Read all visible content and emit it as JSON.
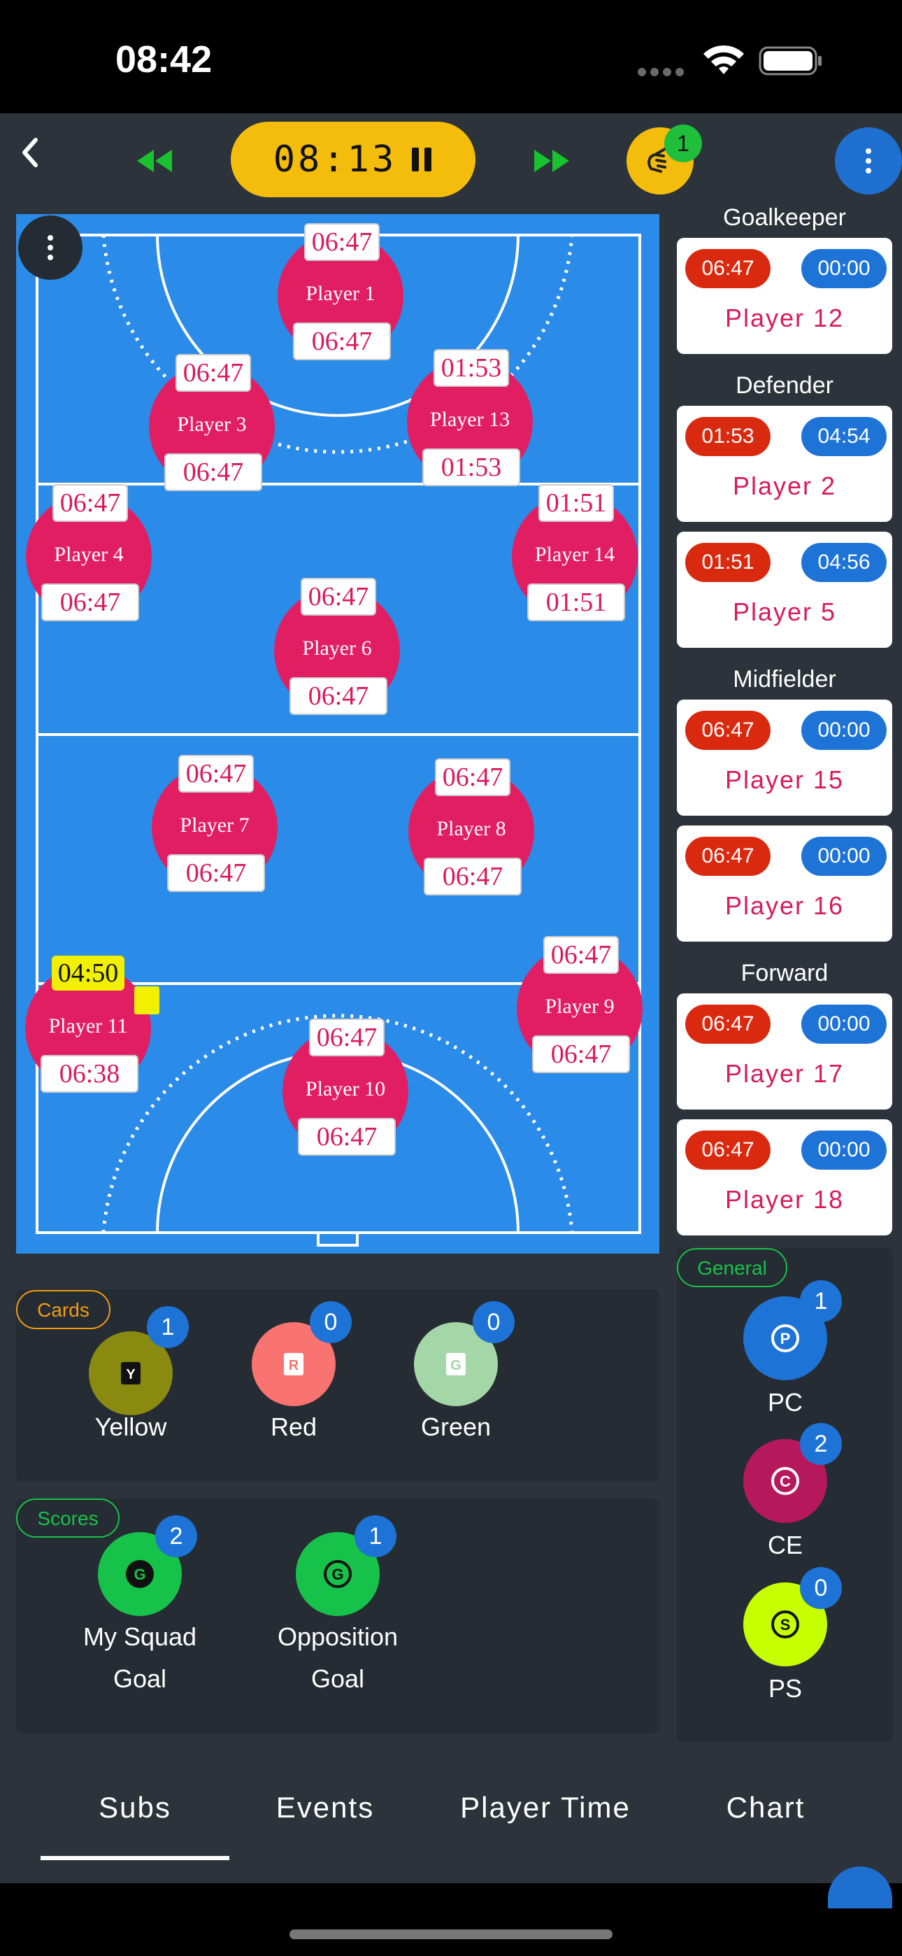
{
  "status_bar": {
    "time": "08:42"
  },
  "toolbar": {
    "timer": "08:13",
    "notification_count": "1"
  },
  "court_players": [
    {
      "name": "Player 1",
      "top_time": "06:47",
      "bottom_time": "06:47"
    },
    {
      "name": "Player 3",
      "top_time": "06:47",
      "bottom_time": "06:47"
    },
    {
      "name": "Player 13",
      "top_time": "01:53",
      "bottom_time": "01:53"
    },
    {
      "name": "Player 4",
      "top_time": "06:47",
      "bottom_time": "06:47"
    },
    {
      "name": "Player 14",
      "top_time": "01:51",
      "bottom_time": "01:51"
    },
    {
      "name": "Player 6",
      "top_time": "06:47",
      "bottom_time": "06:47"
    },
    {
      "name": "Player 7",
      "top_time": "06:47",
      "bottom_time": "06:47"
    },
    {
      "name": "Player 8",
      "top_time": "06:47",
      "bottom_time": "06:47"
    },
    {
      "name": "Player 11",
      "top_time": "04:50",
      "bottom_time": "06:38"
    },
    {
      "name": "Player 9",
      "top_time": "06:47",
      "bottom_time": "06:47"
    },
    {
      "name": "Player 10",
      "top_time": "06:47",
      "bottom_time": "06:47"
    }
  ],
  "bench": {
    "goalkeeper_label": "Goalkeeper",
    "defender_label": "Defender",
    "midfielder_label": "Midfielder",
    "forward_label": "Forward",
    "players": [
      {
        "name": "Player 12",
        "on_time": "06:47",
        "off_time": "00:00"
      },
      {
        "name": "Player 2",
        "on_time": "01:53",
        "off_time": "04:54"
      },
      {
        "name": "Player 5",
        "on_time": "01:51",
        "off_time": "04:56"
      },
      {
        "name": "Player 15",
        "on_time": "06:47",
        "off_time": "00:00"
      },
      {
        "name": "Player 16",
        "on_time": "06:47",
        "off_time": "00:00"
      },
      {
        "name": "Player 17",
        "on_time": "06:47",
        "off_time": "00:00"
      },
      {
        "name": "Player 18",
        "on_time": "06:47",
        "off_time": "00:00"
      }
    ]
  },
  "cards": {
    "label": "Cards",
    "yellow": {
      "letter": "Y",
      "label": "Yellow",
      "count": "1",
      "color": "#8a8a10"
    },
    "red": {
      "letter": "R",
      "label": "Red",
      "count": "0",
      "color": "#f97370"
    },
    "green": {
      "letter": "G",
      "label": "Green",
      "count": "0",
      "color": "#a5d6a7"
    }
  },
  "scores": {
    "label": "Scores",
    "my_squad": {
      "letter": "G",
      "label_line1": "My Squad",
      "label_line2": "Goal",
      "count": "2"
    },
    "opposition": {
      "letter": "G",
      "label_line1": "Opposition",
      "label_line2": "Goal",
      "count": "1"
    }
  },
  "general": {
    "label": "General",
    "pc": {
      "letter": "P",
      "label": "PC",
      "count": "1"
    },
    "ce": {
      "letter": "C",
      "label": "CE",
      "count": "2"
    },
    "ps": {
      "letter": "S",
      "label": "PS",
      "count": "0"
    }
  },
  "tabs": [
    "Subs",
    "Events",
    "Player Time",
    "Chart"
  ],
  "colors": {
    "accent": "#f5bd0b",
    "court": "#2b8be8",
    "player": "#e21e63",
    "on_time": "#d92a10",
    "off_time": "#1e74d6",
    "score_green": "#17c24a"
  }
}
